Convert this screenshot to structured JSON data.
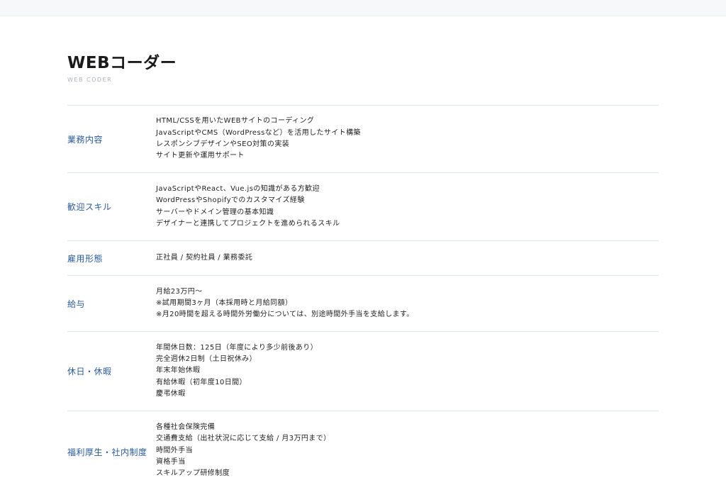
{
  "header": {
    "title": "WEBコーダー",
    "subtitle": "WEB CODER"
  },
  "rows": [
    {
      "label": "業務内容",
      "lines": [
        "HTML/CSSを用いたWEBサイトのコーディング",
        "JavaScriptやCMS（WordPressなど）を活用したサイト構築",
        "レスポンシブデザインやSEO対策の実装",
        "サイト更新や運用サポート"
      ]
    },
    {
      "label": "歓迎スキル",
      "lines": [
        "JavaScriptやReact、Vue.jsの知識がある方歓迎",
        "WordPressやShopifyでのカスタマイズ経験",
        "サーバーやドメイン管理の基本知識",
        "デザイナーと連携してプロジェクトを進められるスキル"
      ]
    },
    {
      "label": "雇用形態",
      "lines": [
        "正社員 / 契約社員 / 業務委託"
      ]
    },
    {
      "label": "給与",
      "lines": [
        "月給23万円〜",
        "※試用期間3ヶ月（本採用時と月給同額）",
        "※月20時間を超える時間外労働分については、別途時間外手当を支給します。"
      ]
    },
    {
      "label": "休日・休暇",
      "lines": [
        "年間休日数：125日（年度により多少前後あり）",
        "完全週休2日制（土日祝休み）",
        "年末年始休暇",
        "有給休暇（初年度10日間）",
        "慶弔休暇"
      ]
    },
    {
      "label": "福利厚生・社内制度",
      "lines": [
        "各種社会保険完備",
        "交通費支給（出社状況に応じて支給 / 月3万円まで）",
        "時間外手当",
        "資格手当",
        "スキルアップ研修制度"
      ]
    }
  ]
}
